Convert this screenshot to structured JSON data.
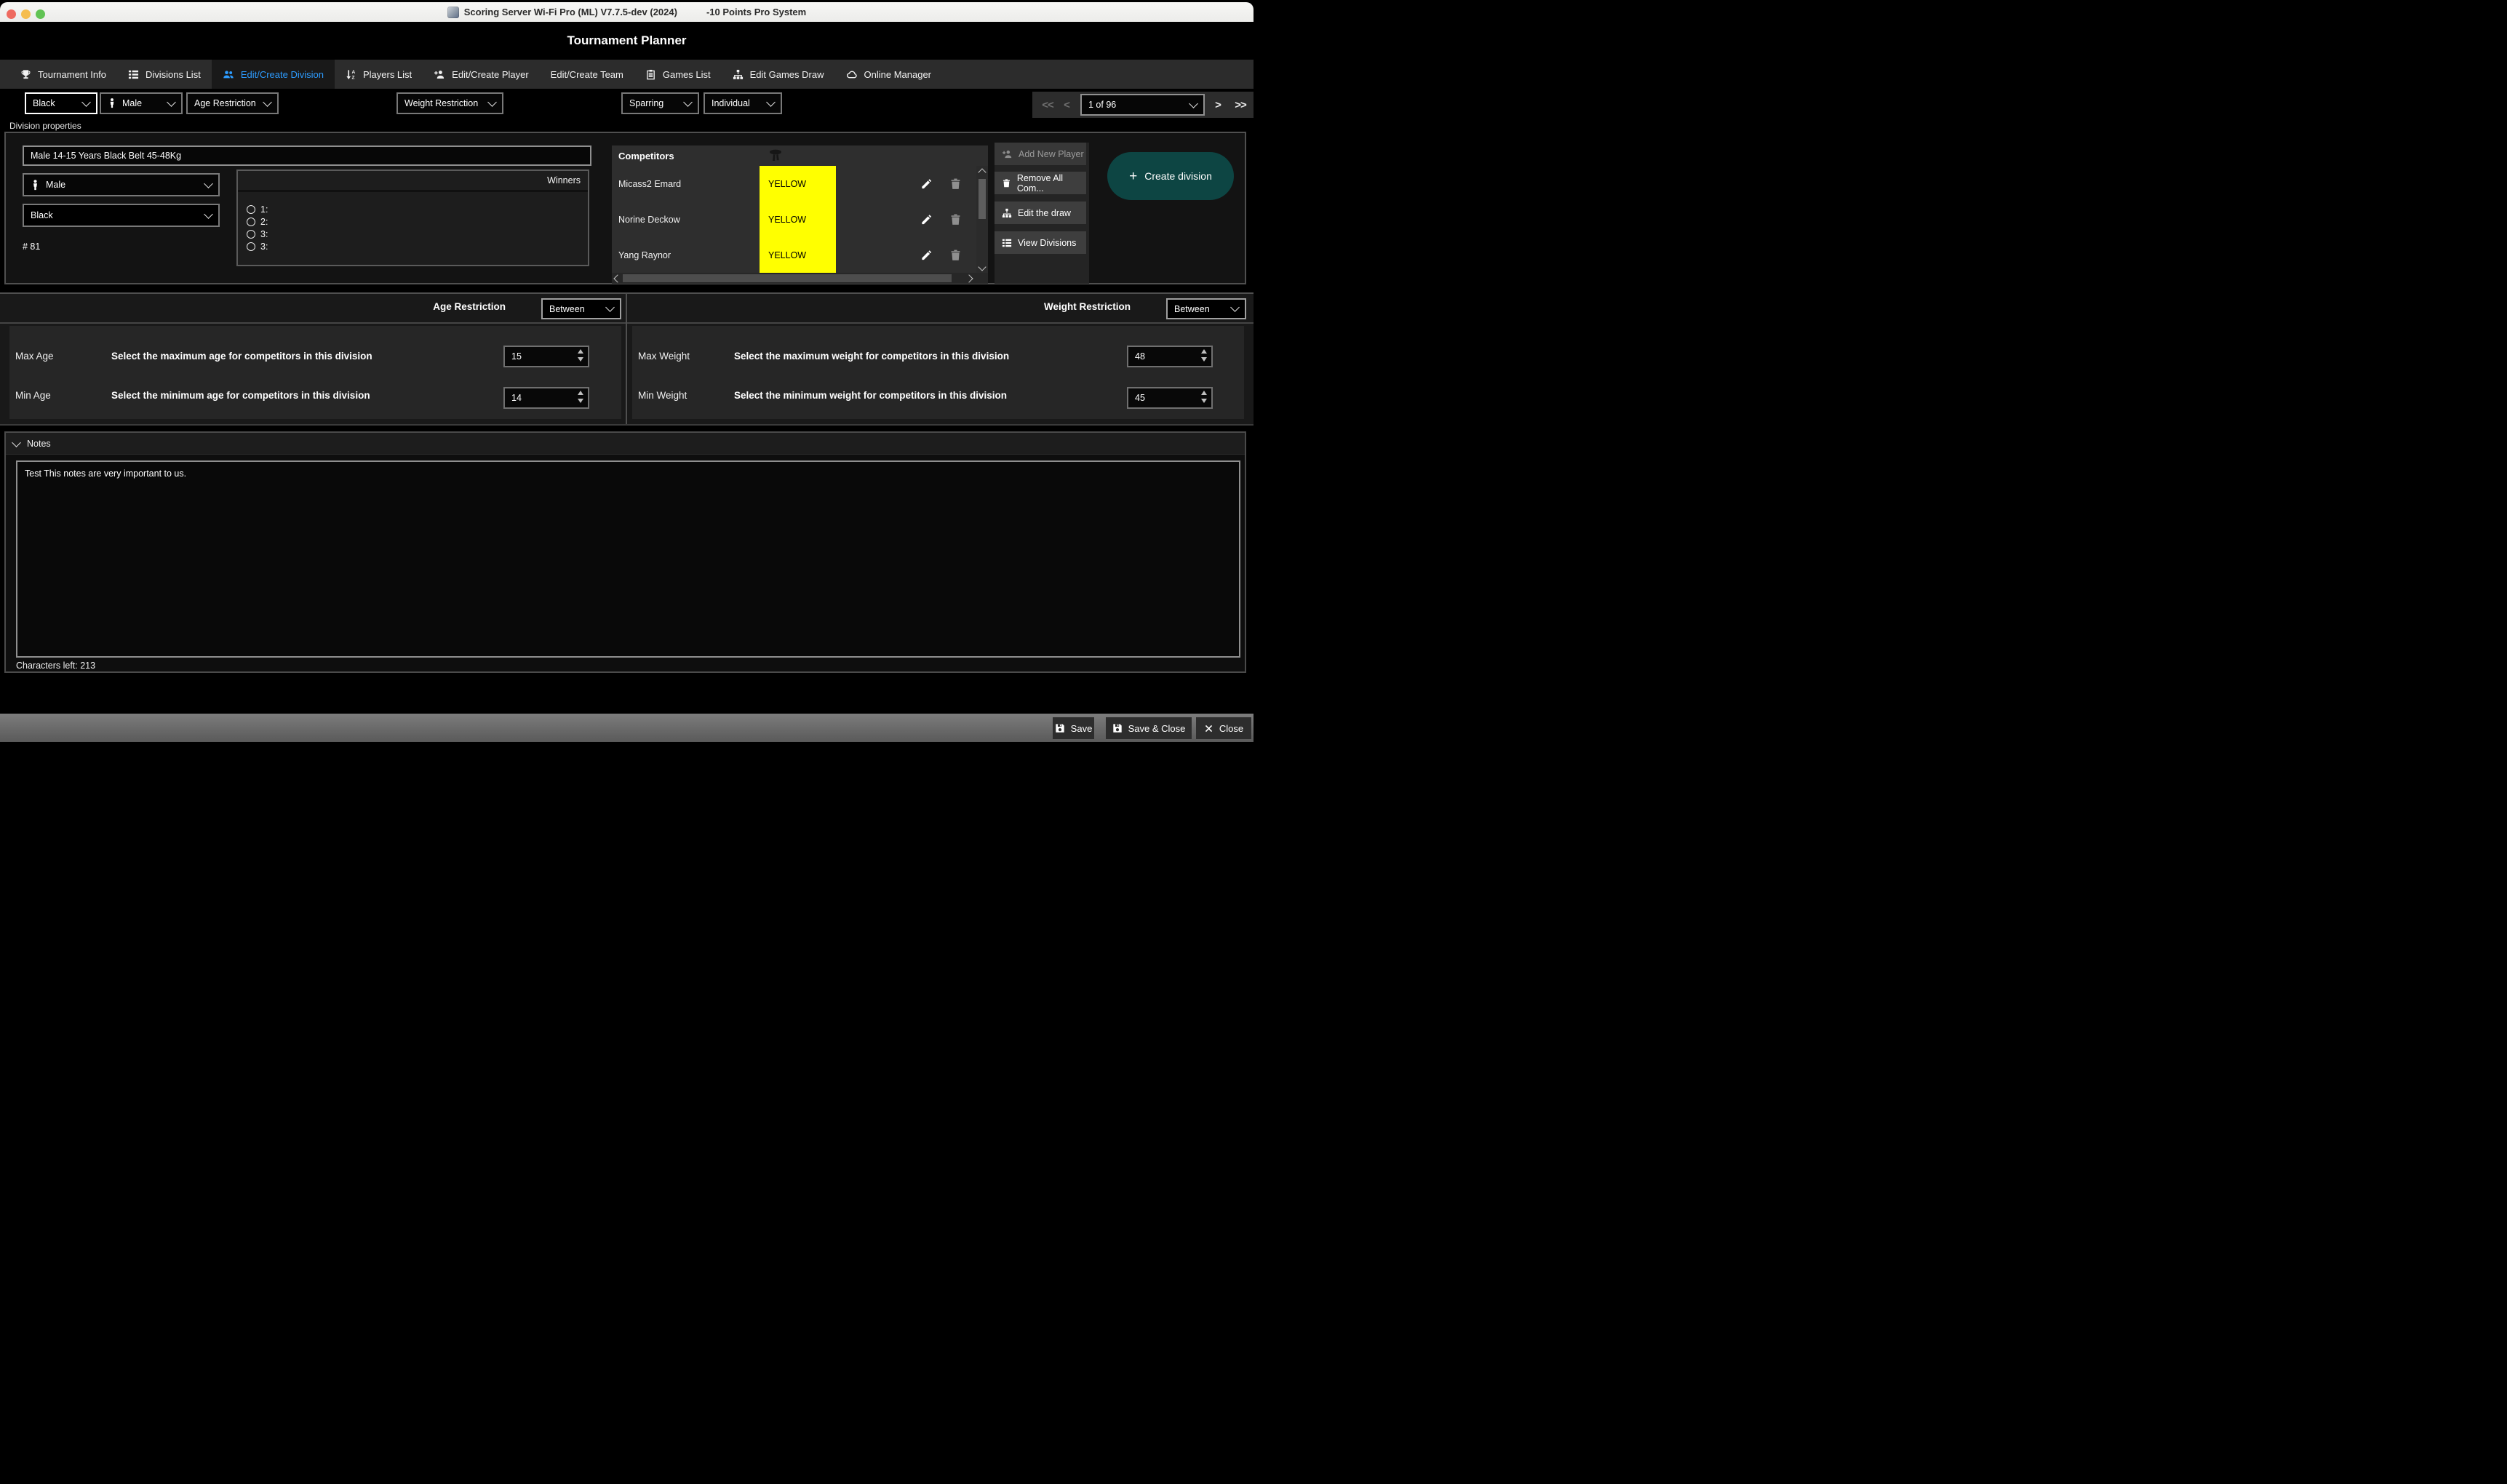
{
  "window": {
    "title_part1": "Scoring Server Wi-Fi Pro (ML) V7.7.5-dev (2024)",
    "title_part2": "-10 Points Pro System",
    "app_header": "Tournament Planner"
  },
  "tabs": [
    {
      "label": "Tournament Info",
      "icon": "trophy-icon",
      "active": false
    },
    {
      "label": "Divisions List",
      "icon": "list-icon",
      "active": false
    },
    {
      "label": "Edit/Create Division",
      "icon": "people-icon",
      "active": true
    },
    {
      "label": "Players List",
      "icon": "sort-az-icon",
      "active": false
    },
    {
      "label": "Edit/Create Player",
      "icon": "person-plus-icon",
      "active": false
    },
    {
      "label": "Edit/Create Team",
      "icon": "none",
      "active": false
    },
    {
      "label": "Games List",
      "icon": "clipboard-icon",
      "active": false
    },
    {
      "label": "Edit Games Draw",
      "icon": "sitemap-icon",
      "active": false
    },
    {
      "label": "Online Manager",
      "icon": "cloud-icon",
      "active": false
    }
  ],
  "filters": {
    "belt": "Black",
    "gender": "Male",
    "age": "Age Restriction",
    "weight": "Weight Restriction",
    "type": "Sparring",
    "mode": "Individual",
    "pagination": {
      "first": "<<",
      "prev": "<",
      "current": "1 of 96",
      "next": ">",
      "last": ">>"
    }
  },
  "division": {
    "section_title": "Division properties",
    "name": "Male 14-15 Years Black Belt 45-48Kg",
    "gender": "Male",
    "belt": "Black",
    "number": "# 81",
    "winners": {
      "title": "Winners",
      "places": [
        "1:",
        "2:",
        "3:",
        "3:"
      ]
    }
  },
  "competitors": {
    "title": "Competitors",
    "rows": [
      {
        "name": "Micass2 Emard",
        "belt": "YELLOW"
      },
      {
        "name": "Norine Deckow",
        "belt": "YELLOW"
      },
      {
        "name": "Yang Raynor",
        "belt": "YELLOW"
      }
    ]
  },
  "actions": {
    "add_new_player": "Add New Player",
    "remove_all": "Remove All Com...",
    "edit_draw": "Edit the draw",
    "view_divisions": "View Divisions",
    "create_division": "Create division",
    "create_plus": "+"
  },
  "age_restriction": {
    "title": "Age Restriction",
    "mode": "Between",
    "rows": [
      {
        "label": "Max Age",
        "description": "Select the maximum age for competitors in this division",
        "value": "15"
      },
      {
        "label": "Min Age",
        "description": "Select the minimum age for competitors in this division",
        "value": "14"
      }
    ]
  },
  "weight_restriction": {
    "title": "Weight Restriction",
    "mode": "Between",
    "rows": [
      {
        "label": "Max Weight",
        "description": "Select the maximum weight for competitors in this division",
        "value": "48"
      },
      {
        "label": "Min Weight",
        "description": "Select the minimum weight for competitors in this division",
        "value": "45"
      }
    ]
  },
  "notes": {
    "title": "Notes",
    "content": "Test This notes are very important to us.",
    "characters_left": "Characters left: 213"
  },
  "footer": {
    "save": "Save",
    "save_close": "Save & Close",
    "close": "Close"
  },
  "colors": {
    "active_tab_blue": "#2d9cff",
    "create_teal": "#0d4543",
    "belt_yellow": "#ffff00",
    "titlebar": "#f2f2f0"
  }
}
